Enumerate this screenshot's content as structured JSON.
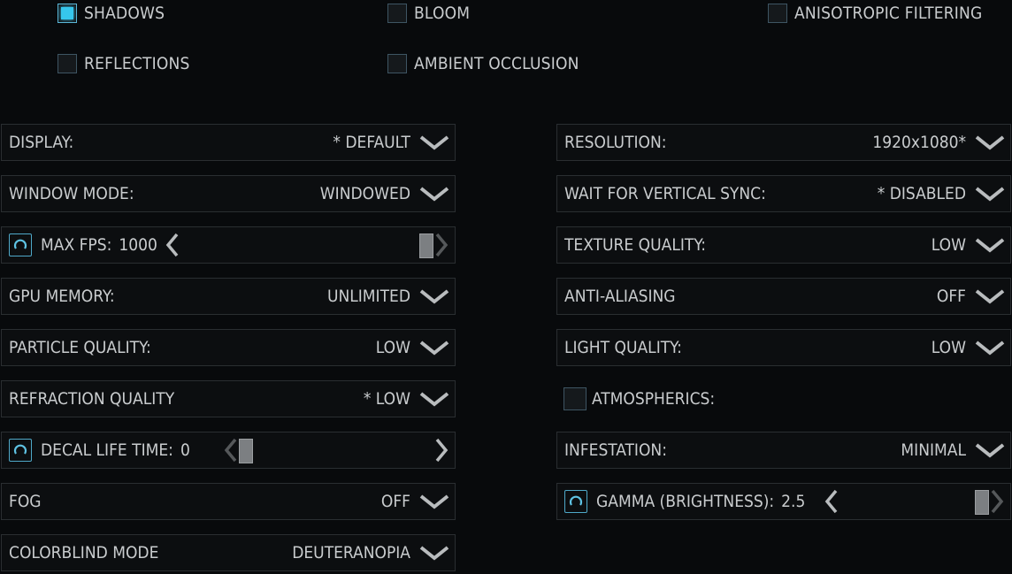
{
  "checkboxes": [
    {
      "label": "SHADOWS",
      "checked": true
    },
    {
      "label": "BLOOM",
      "checked": false
    },
    {
      "label": "ANISOTROPIC FILTERING",
      "checked": false
    },
    {
      "label": "REFLECTIONS",
      "checked": false
    },
    {
      "label": "AMBIENT OCCLUSION",
      "checked": false
    }
  ],
  "left": {
    "display": {
      "label": "DISPLAY:",
      "value": "* DEFAULT"
    },
    "window_mode": {
      "label": "WINDOW MODE:",
      "value": "WINDOWED"
    },
    "max_fps": {
      "label": "MAX FPS:",
      "value": "1000",
      "level": 1.0
    },
    "gpu_memory": {
      "label": "GPU MEMORY:",
      "value": "UNLIMITED"
    },
    "particle_quality": {
      "label": "PARTICLE QUALITY:",
      "value": "LOW"
    },
    "refraction_quality": {
      "label": "REFRACTION QUALITY",
      "value": "* LOW"
    },
    "decal_life_time": {
      "label": "DECAL LIFE TIME:",
      "value": "0",
      "level": 0.0
    },
    "fog": {
      "label": "FOG",
      "value": "OFF"
    },
    "colorblind_mode": {
      "label": "COLORBLIND MODE",
      "value": "DEUTERANOPIA"
    }
  },
  "right": {
    "resolution": {
      "label": "RESOLUTION:",
      "value": "1920x1080*"
    },
    "vsync": {
      "label": "WAIT FOR VERTICAL SYNC:",
      "value": "* DISABLED"
    },
    "texture_quality": {
      "label": "TEXTURE QUALITY:",
      "value": "LOW"
    },
    "anti_aliasing": {
      "label": "ANTI-ALIASING",
      "value": "OFF"
    },
    "light_quality": {
      "label": "LIGHT QUALITY:",
      "value": "LOW"
    },
    "atmospherics": {
      "label": "ATMOSPHERICS:",
      "checked": false
    },
    "infestation": {
      "label": "INFESTATION:",
      "value": "MINIMAL"
    },
    "gamma": {
      "label": "GAMMA (BRIGHTNESS):",
      "value": "2.5",
      "level": 1.0
    }
  },
  "colors": {
    "accent": "#36c6ec",
    "text": "#c9ccce",
    "row_border": "#2a2e31"
  },
  "icons": {
    "dropdown": "chevron-down-icon",
    "reset": "reset-icon",
    "left": "chevron-left-icon",
    "right": "chevron-right-icon"
  }
}
